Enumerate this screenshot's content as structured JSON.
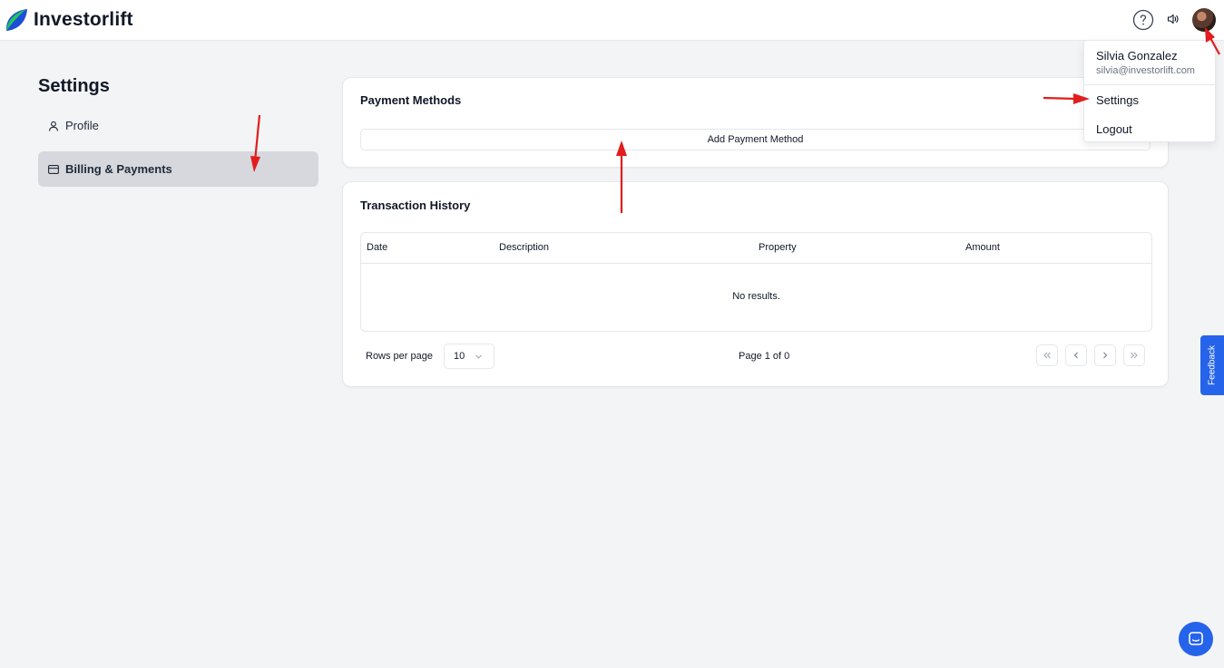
{
  "app": {
    "name": "Investorlift",
    "brand_colors": {
      "leaf_blue": "#1d4ed8",
      "leaf_green": "#22c55e"
    }
  },
  "header": {
    "help_icon": "question-circle-icon",
    "sound_icon": "speaker-icon",
    "avatar_icon": "user-avatar"
  },
  "user_menu": {
    "name": "Silvia Gonzalez",
    "email": "silvia@investorlift.com",
    "items": [
      "Settings",
      "Logout"
    ]
  },
  "sidebar": {
    "title": "Settings",
    "items": [
      {
        "label": "Profile",
        "icon": "user-icon",
        "active": false
      },
      {
        "label": "Billing & Payments",
        "icon": "credit-card-icon",
        "active": true
      }
    ]
  },
  "payment_methods": {
    "title": "Payment Methods",
    "add_button": "Add Payment Method"
  },
  "transaction_history": {
    "title": "Transaction History",
    "columns": [
      "Date",
      "Description",
      "Property",
      "Amount"
    ],
    "empty_text": "No results.",
    "rows_per_page_label": "Rows per page",
    "rows_per_page_value": "10",
    "page_label": "Page 1 of 0",
    "pager_icons": [
      "first-page-icon",
      "prev-page-icon",
      "next-page-icon",
      "last-page-icon"
    ]
  },
  "feedback": {
    "label": "Feedback"
  },
  "chat": {
    "icon": "chat-icon"
  },
  "annotation_color": "#e11d1d"
}
